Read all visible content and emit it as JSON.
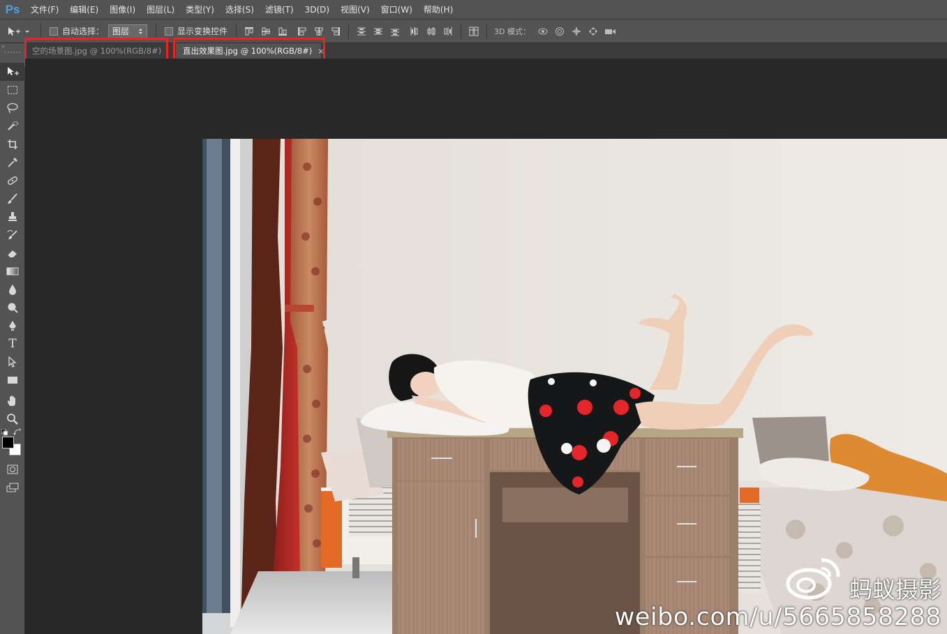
{
  "app": {
    "logo_text": "Ps"
  },
  "menu": {
    "items": [
      {
        "label": "文件(F)"
      },
      {
        "label": "编辑(E)"
      },
      {
        "label": "图像(I)"
      },
      {
        "label": "图层(L)"
      },
      {
        "label": "类型(Y)"
      },
      {
        "label": "选择(S)"
      },
      {
        "label": "滤镜(T)"
      },
      {
        "label": "3D(D)"
      },
      {
        "label": "视图(V)"
      },
      {
        "label": "窗口(W)"
      },
      {
        "label": "帮助(H)"
      }
    ]
  },
  "options": {
    "auto_select_label": "自动选择：",
    "auto_select_checked": false,
    "auto_select_target": "图层",
    "show_transform_label": "显示变换控件",
    "show_transform_checked": false,
    "mode_3d_label": "3D 模式："
  },
  "tabs": [
    {
      "title": "空的场景图.jpg @ 100%(RGB/8#)",
      "active": false
    },
    {
      "title": "直出效果图.jpg @ 100%(RGB/8#)",
      "active": true,
      "close": "×"
    }
  ],
  "tools": [
    "move-tool",
    "marquee-tool",
    "lasso-tool",
    "quick-selection-tool",
    "crop-tool",
    "eyedropper-tool",
    "healing-brush-tool",
    "brush-tool",
    "clone-stamp-tool",
    "history-brush-tool",
    "eraser-tool",
    "gradient-tool",
    "blur-tool",
    "dodge-tool",
    "pen-tool",
    "type-tool",
    "path-selection-tool",
    "rectangle-tool",
    "hand-tool",
    "zoom-tool"
  ],
  "type_tool_glyph": "T",
  "colors": {
    "foreground": "#000000",
    "background": "#ffffff",
    "highlight": "#ee2222"
  },
  "watermark": {
    "name": "蚂蚁摄影",
    "url": "weibo.com/u/5665858288"
  }
}
